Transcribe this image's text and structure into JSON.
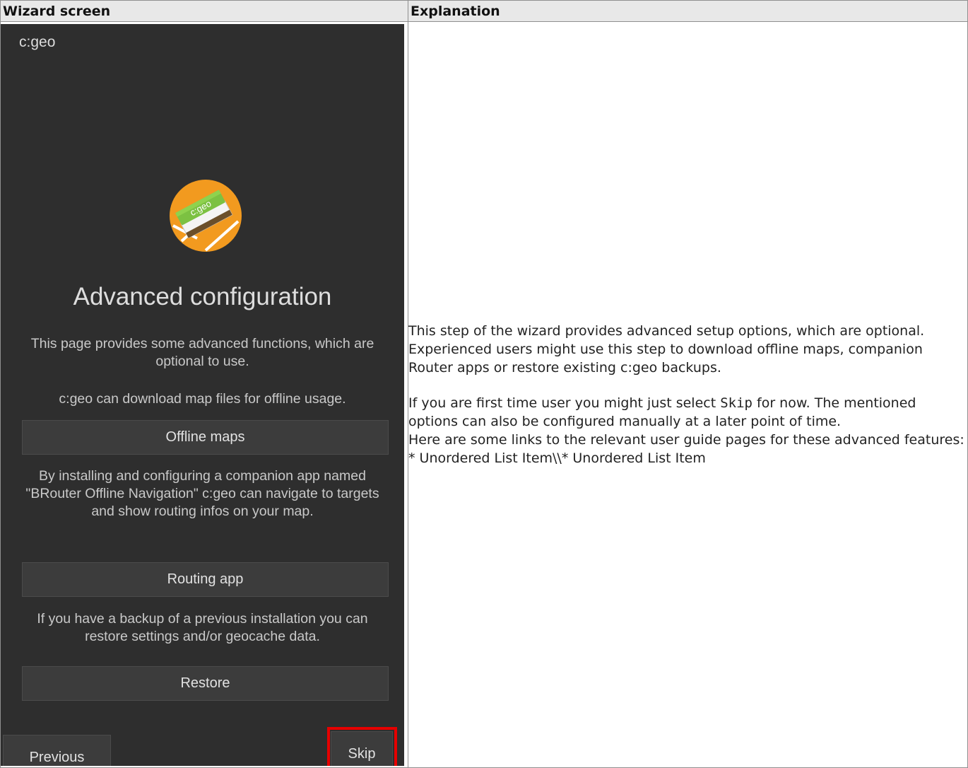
{
  "table": {
    "header_left": "Wizard screen",
    "header_right": "Explanation"
  },
  "wizard": {
    "app_name": "c:geo",
    "logo_text": "c:geo",
    "title": "Advanced configuration",
    "intro": "This page provides some advanced functions, which are optional to use.",
    "maps_text": "c:geo can download map files for offline usage.",
    "maps_button": "Offline maps",
    "routing_text": "By installing and configuring a companion app named \"BRouter Offline Navigation\" c:geo can navigate to targets and show routing infos on your map.",
    "routing_button": "Routing app",
    "restore_text": "If you have a backup of a previous installation you can restore settings and/or geocache data.",
    "restore_button": "Restore",
    "previous_button": "Previous",
    "skip_button": "Skip"
  },
  "explanation": {
    "para1": "This step of the wizard provides advanced setup options, which are optional. Experienced users might use this step to download offline maps, companion Router apps or restore existing c:geo backups.",
    "para2_a": "If you are first time user you might just select ",
    "para2_code": "Skip",
    "para2_b": " for now. The mentioned options can also be configured manually at a later point of time.",
    "para3": "Here are some links to the relevant user guide pages for these advanced features:",
    "list_line": "* Unordered List Item\\\\* Unordered List Item"
  },
  "colors": {
    "phone_bg": "#2e2e2e",
    "button_bg": "#3c3c3c",
    "highlight": "#e60000",
    "logo_orange": "#f29a1f"
  }
}
